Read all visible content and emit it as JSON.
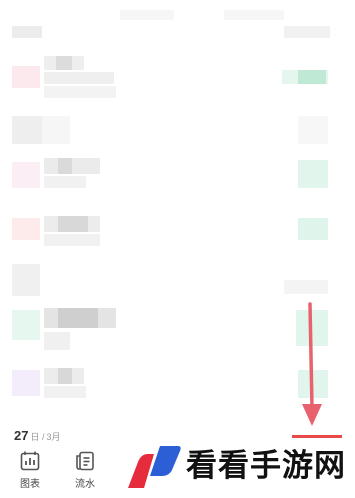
{
  "footer": {
    "date_day": "27",
    "date_sep": "日 / ",
    "date_month": "3月"
  },
  "tabs": [
    {
      "label": "图表",
      "icon": "bar-chart-icon"
    },
    {
      "label": "流水",
      "icon": "ledger-icon"
    }
  ],
  "watermark": {
    "text": "看看手游网",
    "logo": "brand-logo"
  },
  "colors": {
    "accent_red": "#e84a4a",
    "arrow_red": "#e8626e",
    "income_green": "#7ed6b0"
  }
}
